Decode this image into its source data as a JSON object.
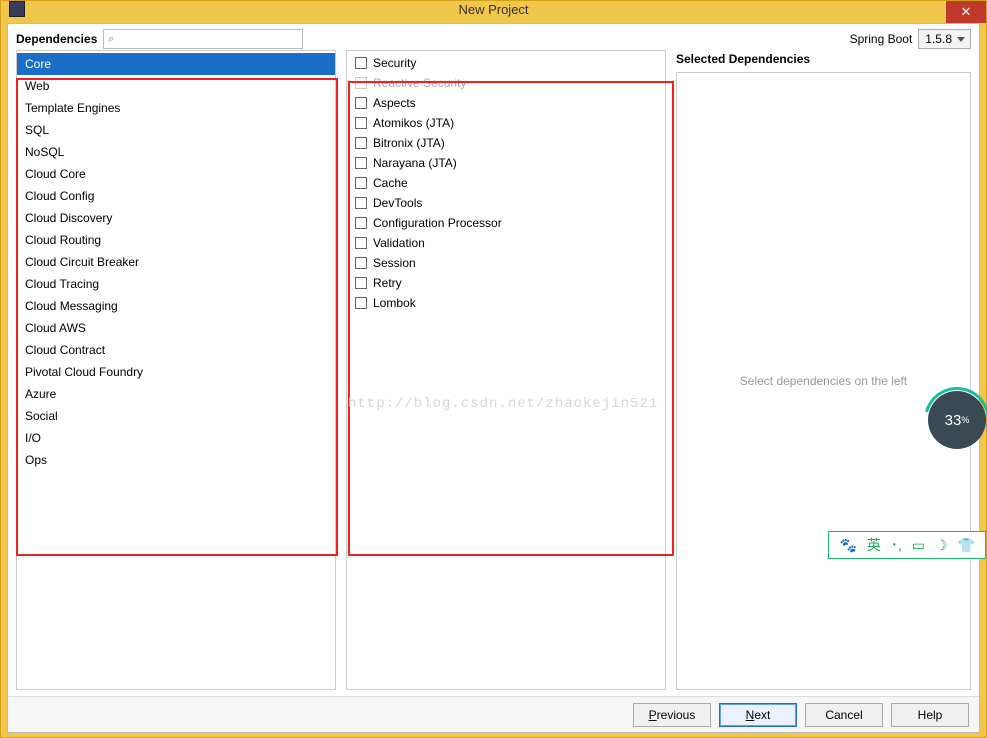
{
  "window": {
    "title": "New Project",
    "close": "✕"
  },
  "header": {
    "dependencies_label": "Dependencies",
    "search_placeholder": "",
    "spring_boot_label": "Spring Boot",
    "spring_boot_version": "1.5.8"
  },
  "categories": [
    {
      "label": "Core"
    },
    {
      "label": "Web"
    },
    {
      "label": "Template Engines"
    },
    {
      "label": "SQL"
    },
    {
      "label": "NoSQL"
    },
    {
      "label": "Cloud Core"
    },
    {
      "label": "Cloud Config"
    },
    {
      "label": "Cloud Discovery"
    },
    {
      "label": "Cloud Routing"
    },
    {
      "label": "Cloud Circuit Breaker"
    },
    {
      "label": "Cloud Tracing"
    },
    {
      "label": "Cloud Messaging"
    },
    {
      "label": "Cloud AWS"
    },
    {
      "label": "Cloud Contract"
    },
    {
      "label": "Pivotal Cloud Foundry"
    },
    {
      "label": "Azure"
    },
    {
      "label": "Social"
    },
    {
      "label": "I/O"
    },
    {
      "label": "Ops"
    }
  ],
  "selected_category_index": 0,
  "dependencies": [
    {
      "label": "Security",
      "disabled": false
    },
    {
      "label": "Reactive Security",
      "disabled": true
    },
    {
      "label": "Aspects",
      "disabled": false
    },
    {
      "label": "Atomikos (JTA)",
      "disabled": false
    },
    {
      "label": "Bitronix (JTA)",
      "disabled": false
    },
    {
      "label": "Narayana (JTA)",
      "disabled": false
    },
    {
      "label": "Cache",
      "disabled": false
    },
    {
      "label": "DevTools",
      "disabled": false
    },
    {
      "label": "Configuration Processor",
      "disabled": false
    },
    {
      "label": "Validation",
      "disabled": false
    },
    {
      "label": "Session",
      "disabled": false
    },
    {
      "label": "Retry",
      "disabled": false
    },
    {
      "label": "Lombok",
      "disabled": false
    }
  ],
  "selected_panel": {
    "title": "Selected Dependencies",
    "empty_text": "Select dependencies on the left"
  },
  "buttons": {
    "previous": "Previous",
    "next": "Next",
    "cancel": "Cancel",
    "help": "Help"
  },
  "watermark": "http://blog.csdn.net/zhaokejin521",
  "gauge": {
    "value": "33",
    "suffix": "%"
  },
  "tray_icons": [
    "🐾",
    "英",
    "･,",
    "▭",
    "☽",
    "👕"
  ]
}
